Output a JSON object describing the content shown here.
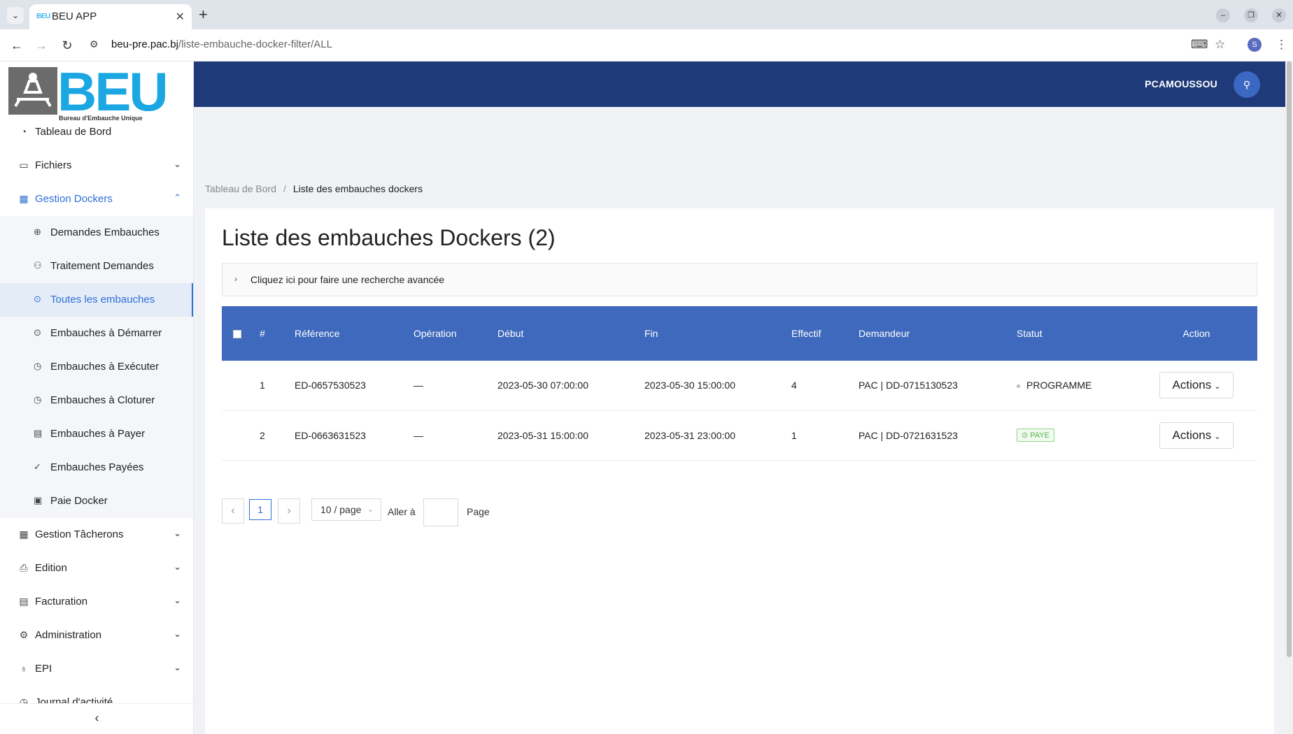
{
  "browser": {
    "tab_title": "BEU APP",
    "tab_favicon_text": "BEU",
    "url_host": "beu-pre.pac.bj",
    "url_path": "/liste-embauche-docker-filter/ALL",
    "profile_initial": "S"
  },
  "logo": {
    "text": "BEU",
    "subtitle": "Bureau d'Embauche Unique"
  },
  "sidebar": {
    "items": [
      {
        "label": "Tableau de Bord",
        "icon": "dashboard-icon"
      },
      {
        "label": "Fichiers",
        "icon": "folder-icon"
      },
      {
        "label": "Gestion Dockers",
        "icon": "grid-icon"
      },
      {
        "label": "Gestion Tâcherons",
        "icon": "grid-icon"
      },
      {
        "label": "Edition",
        "icon": "printer-icon"
      },
      {
        "label": "Facturation",
        "icon": "invoice-icon"
      },
      {
        "label": "Administration",
        "icon": "gear-icon"
      },
      {
        "label": "EPI",
        "icon": "shirt-icon"
      },
      {
        "label": "Journal d'activité",
        "icon": "history-icon"
      }
    ],
    "sub_items": [
      {
        "label": "Demandes Embauches"
      },
      {
        "label": "Traitement Demandes"
      },
      {
        "label": "Toutes les embauches"
      },
      {
        "label": "Embauches à Démarrer"
      },
      {
        "label": "Embauches à Exécuter"
      },
      {
        "label": "Embauches à Cloturer"
      },
      {
        "label": "Embauches à Payer"
      },
      {
        "label": "Embauches Payées"
      },
      {
        "label": "Paie Docker"
      }
    ]
  },
  "header": {
    "username": "PCAMOUSSOU"
  },
  "breadcrumb": {
    "home": "Tableau de Bord",
    "current": "Liste des embauches dockers"
  },
  "page": {
    "title": "Liste des embauches Dockers (2)",
    "advanced_search": "Cliquez ici pour faire une recherche avancée"
  },
  "table": {
    "headers": [
      "#",
      "Référence",
      "Opération",
      "Début",
      "Fin",
      "Effectif",
      "Demandeur",
      "Statut",
      "Action"
    ],
    "rows": [
      {
        "num": "1",
        "ref": "ED-0657530523",
        "op": "—",
        "debut": "2023-05-30 07:00:00",
        "fin": "2023-05-30 15:00:00",
        "effectif": "4",
        "demandeur": "PAC | DD-0715130523",
        "statut": "PROGRAMME",
        "action": "Actions"
      },
      {
        "num": "2",
        "ref": "ED-0663631523",
        "op": "—",
        "debut": "2023-05-31 15:00:00",
        "fin": "2023-05-31 23:00:00",
        "effectif": "1",
        "demandeur": "PAC | DD-0721631523",
        "statut": "PAYE",
        "action": "Actions"
      }
    ]
  },
  "pagination": {
    "current": "1",
    "page_size": "10 / page",
    "goto_label": "Aller à",
    "page_label": "Page"
  },
  "colors": {
    "header_bg": "#1e3a78",
    "table_header_bg": "#3e69bd",
    "accent": "#2d6fd6",
    "paid_green": "#52b34a"
  }
}
